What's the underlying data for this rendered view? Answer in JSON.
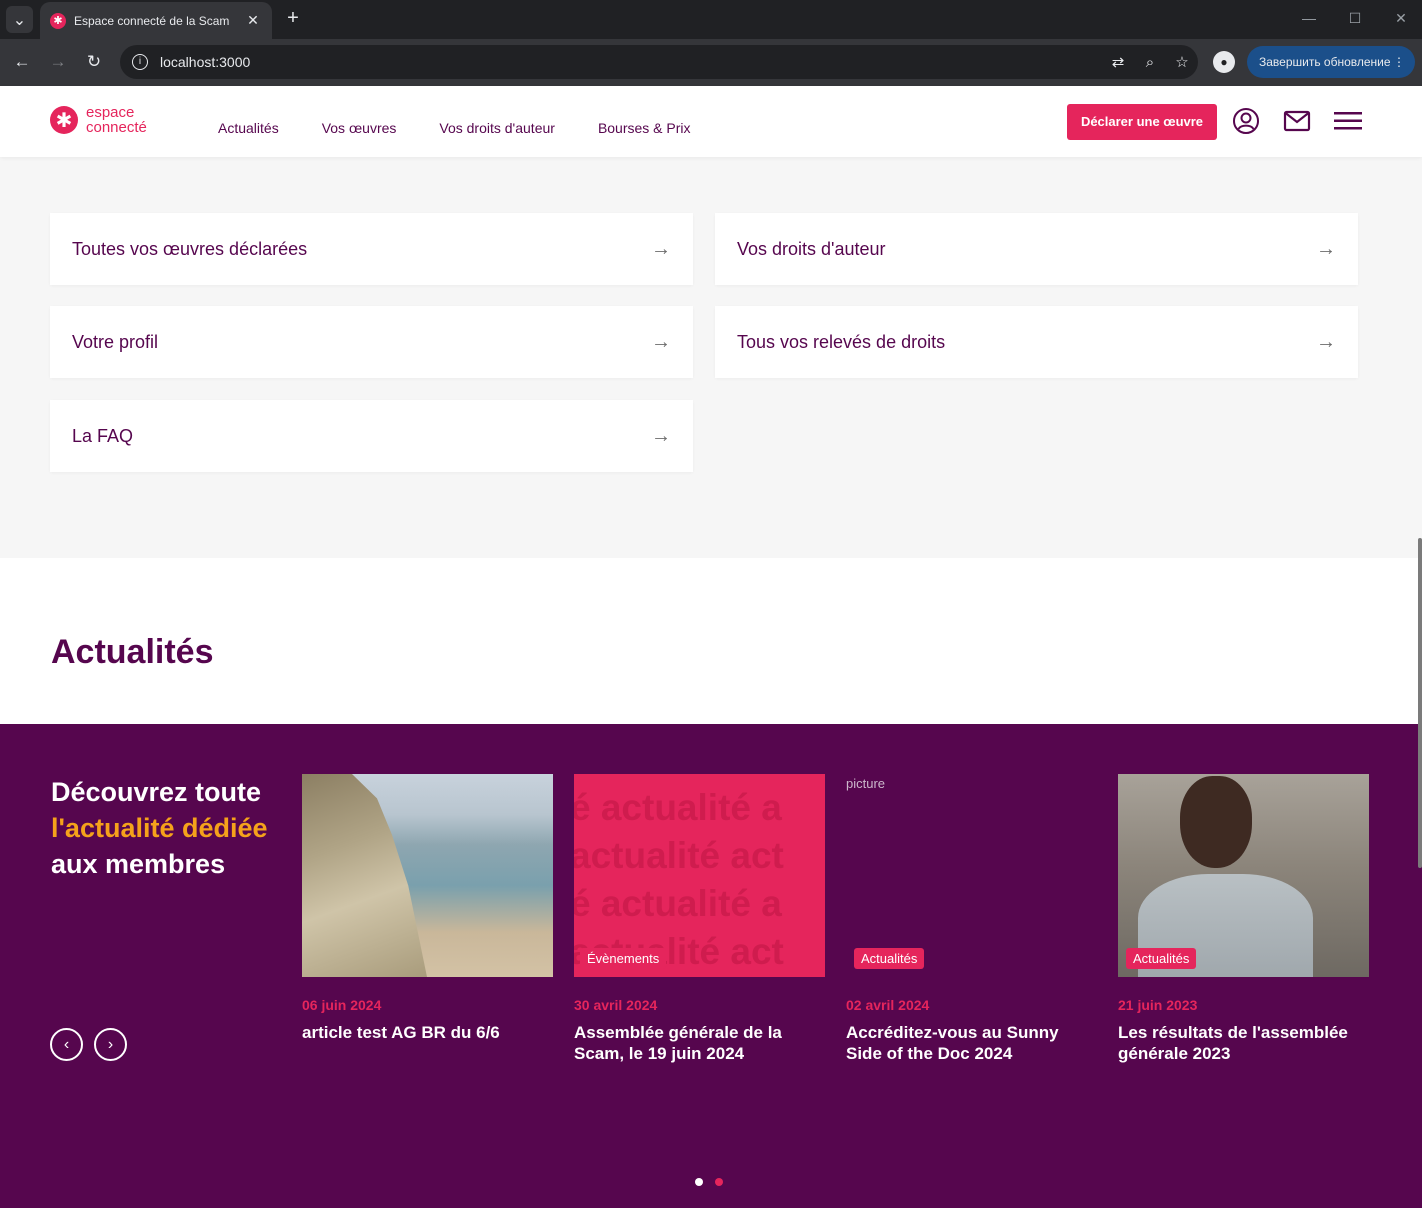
{
  "browser": {
    "tab_title": "Espace connecté de la Scam",
    "tab_favicon": "✱",
    "url": "localhost:3000",
    "update_label": "Завершить обновление"
  },
  "header": {
    "logo_line1": "espace",
    "logo_line2": "connecté",
    "nav": [
      "Actualités",
      "Vos œuvres",
      "Vos droits d'auteur",
      "Bourses & Prix"
    ],
    "cta_label": "Déclarer une œuvre"
  },
  "quick_links": [
    {
      "label": "Toutes vos œuvres déclarées"
    },
    {
      "label": "Vos droits d'auteur"
    },
    {
      "label": "Votre profil"
    },
    {
      "label": "Tous vos relevés de droits"
    },
    {
      "label": "La FAQ"
    }
  ],
  "news": {
    "section_title": "Actualités",
    "promo_line1": "Découvrez toute",
    "promo_line2": "l'actualité dédiée",
    "promo_line3": "aux membres",
    "items": [
      {
        "date": "06 juin 2024",
        "title": "article test AG BR du 6/6",
        "badge": ""
      },
      {
        "date": "30 avril 2024",
        "title": "Assemblée générale de la Scam, le 19 juin 2024",
        "badge": "Évènements"
      },
      {
        "date": "02 avril 2024",
        "title": "Accréditez-vous au Sunny Side of the Doc 2024",
        "badge": "Actualités",
        "image_alt": "picture"
      },
      {
        "date": "21 juin 2023",
        "title": "Les résultats de l'assemblée générale 2023",
        "badge": "Actualités"
      }
    ],
    "pattern_lines": [
      "é actualité a",
      "actualité act",
      "é actualité a",
      "actualité act"
    ],
    "pagination": {
      "pages": 2,
      "current": 1
    }
  },
  "colors": {
    "brand_pink": "#e5255c",
    "brand_purple": "#56064e",
    "highlight": "#f5a21b"
  }
}
